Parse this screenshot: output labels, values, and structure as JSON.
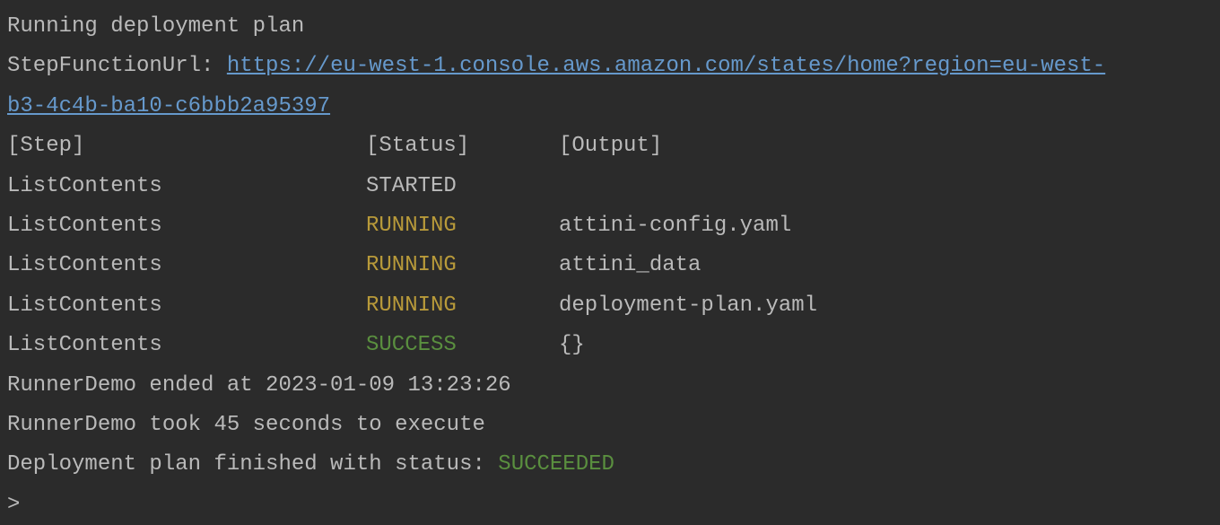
{
  "header": {
    "running_text": "Running deployment plan",
    "step_function_label": "StepFunctionUrl: ",
    "step_function_url_line1": "https://eu-west-1.console.aws.amazon.com/states/home?region=eu-west-",
    "step_function_url_line2": "b3-4c4b-ba10-c6bbb2a95397"
  },
  "columns": {
    "step": "[Step]",
    "status": "[Status]",
    "output": "[Output]"
  },
  "rows": [
    {
      "step": "ListContents",
      "status": "STARTED",
      "status_class": "",
      "output": ""
    },
    {
      "step": "ListContents",
      "status": "RUNNING",
      "status_class": "status-running",
      "output": "attini-config.yaml"
    },
    {
      "step": "ListContents",
      "status": "RUNNING",
      "status_class": "status-running",
      "output": "attini_data"
    },
    {
      "step": "ListContents",
      "status": "RUNNING",
      "status_class": "status-running",
      "output": "deployment-plan.yaml"
    },
    {
      "step": "ListContents",
      "status": "SUCCESS",
      "status_class": "status-success",
      "output": "{}"
    }
  ],
  "footer": {
    "ended_at": "RunnerDemo ended at 2023-01-09 13:23:26",
    "duration": "RunnerDemo took 45 seconds to execute",
    "finished_prefix": "Deployment plan finished with status: ",
    "finished_status": "SUCCEEDED",
    "prompt": ">"
  }
}
